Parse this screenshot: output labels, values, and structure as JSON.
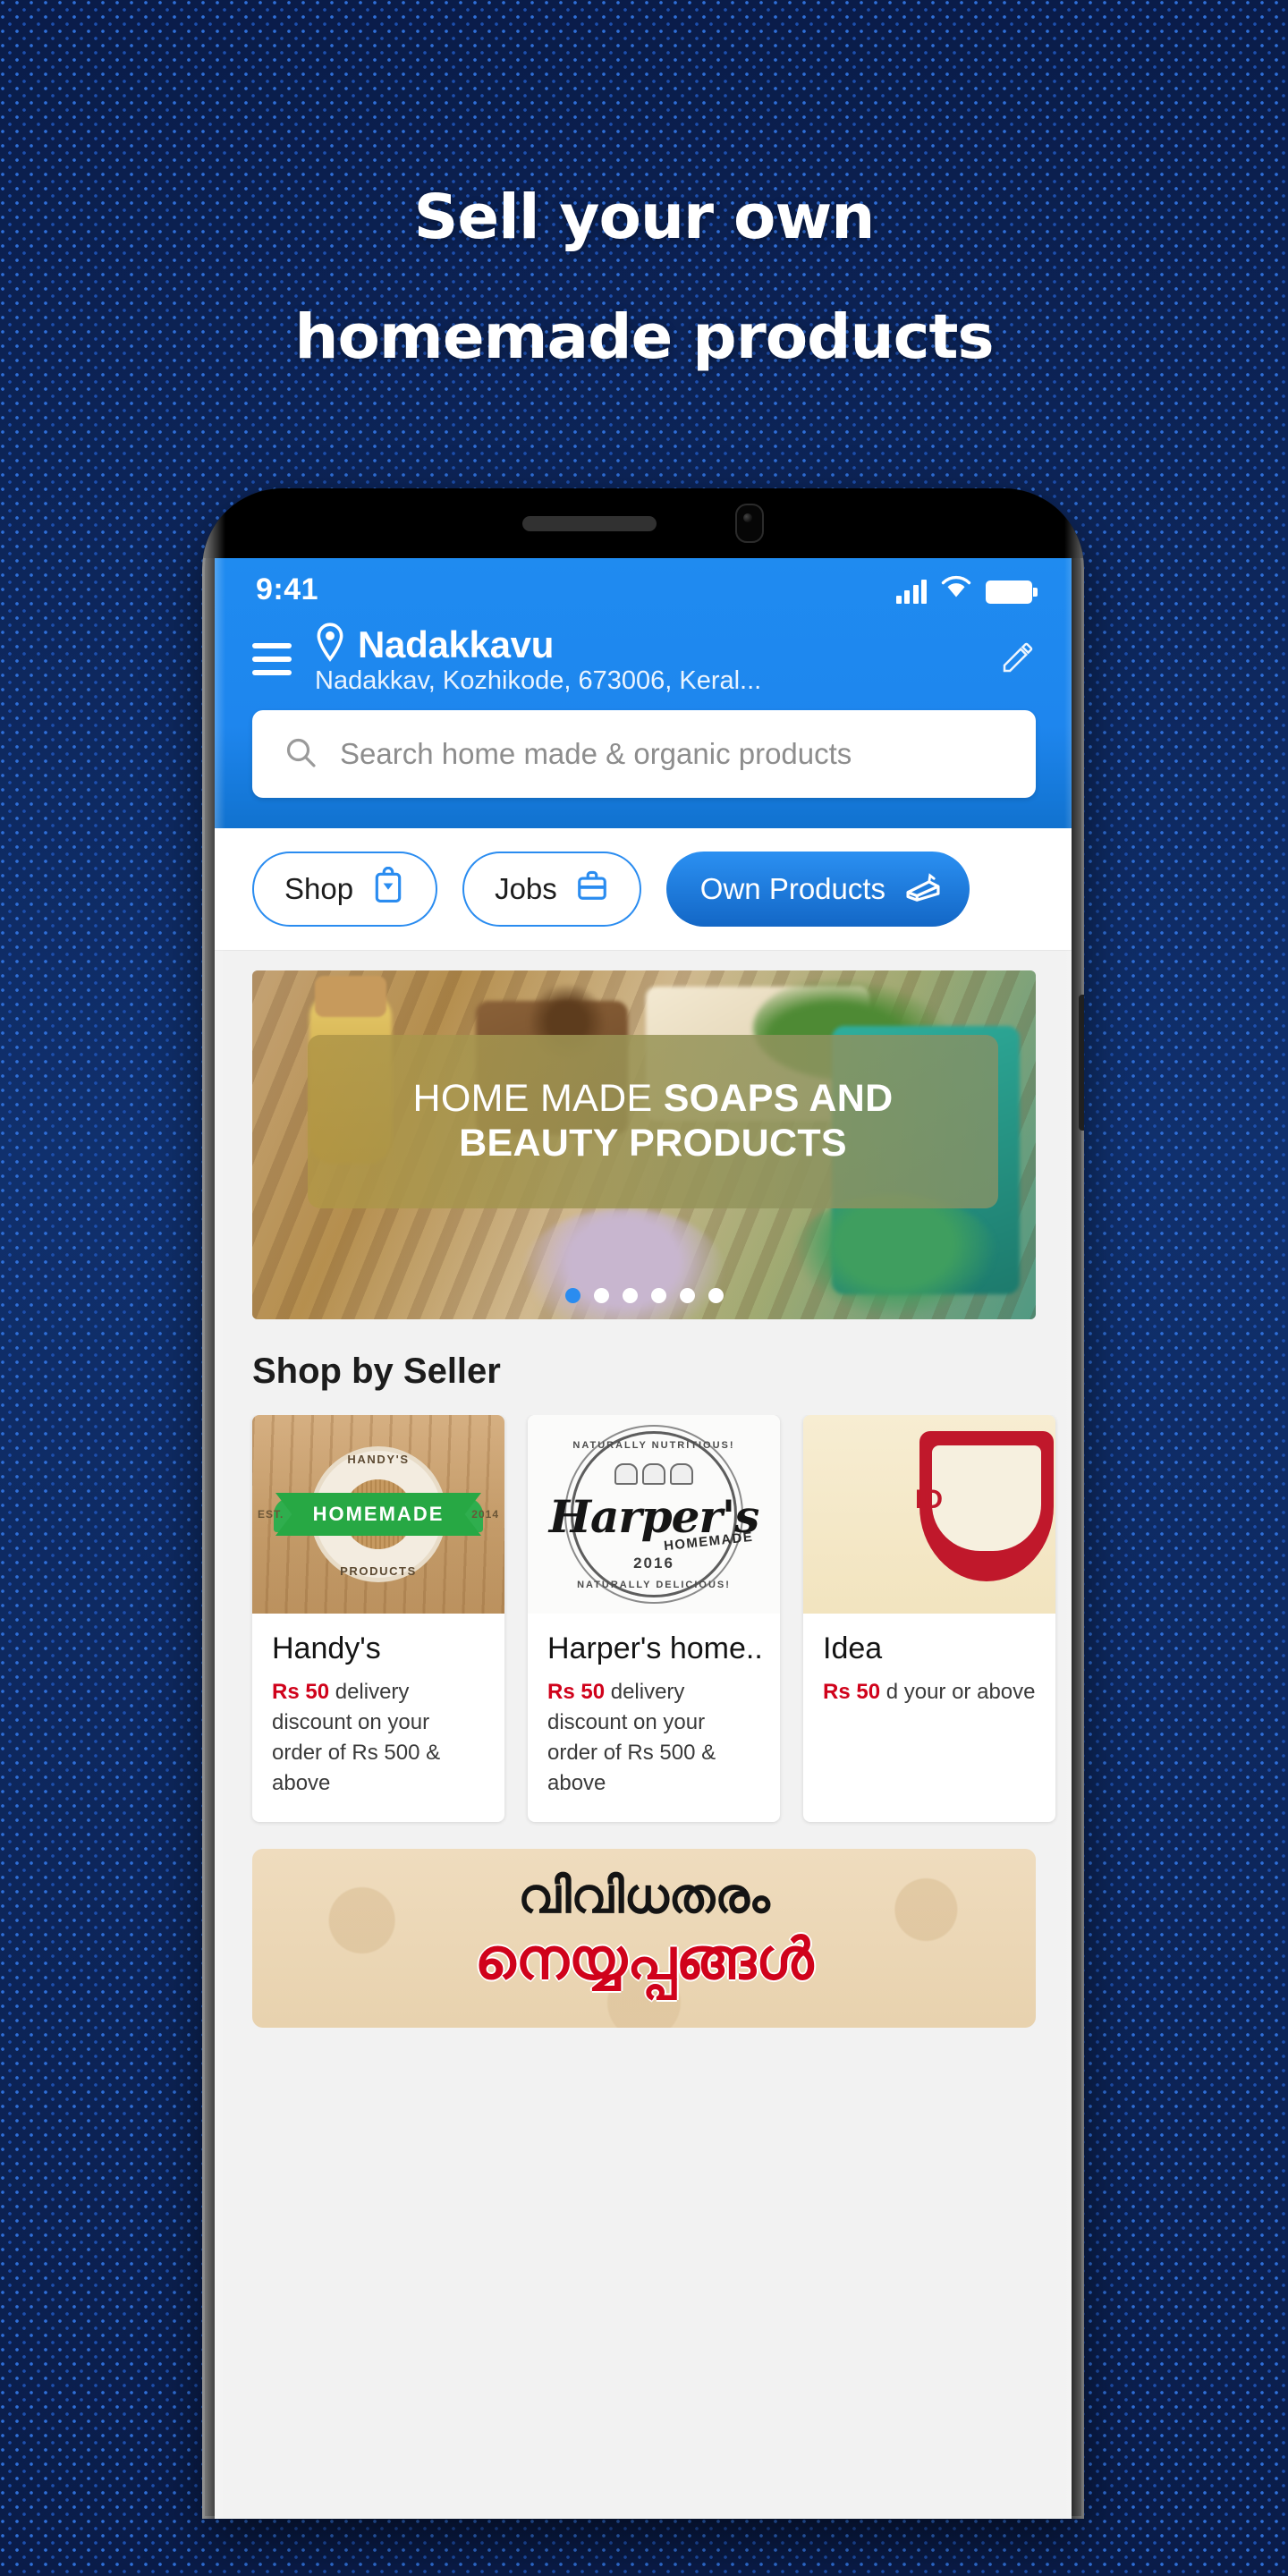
{
  "promo": {
    "headline_line1": "Sell your own",
    "headline_line2": "homemade products"
  },
  "phone": {
    "status_bar": {
      "time": "9:41",
      "signal_icon": "cellular-signal-icon",
      "wifi_icon": "wifi-icon",
      "battery_icon": "battery-icon"
    },
    "header": {
      "menu_icon": "hamburger-menu-icon",
      "location_pin_icon": "location-pin-icon",
      "location_title": "Nadakkavu",
      "location_address": "Nadakkav, Kozhikode, 673006, Keral...",
      "edit_icon": "pencil-edit-icon"
    },
    "search": {
      "icon": "search-icon",
      "placeholder": "Search home made & organic products",
      "value": ""
    },
    "chips": [
      {
        "label": "Shop",
        "icon": "shopping-bag-icon",
        "active": false
      },
      {
        "label": "Jobs",
        "icon": "briefcase-icon",
        "active": false
      },
      {
        "label": "Own Products",
        "icon": "cake-slice-icon",
        "active": true
      }
    ],
    "banner": {
      "title_light": "HOME MADE ",
      "title_bold": "SOAPS AND",
      "title_line2": "BEAUTY PRODUCTS",
      "dots_total": 6,
      "dots_active_index": 0
    },
    "sellers": {
      "section_title": "Shop by Seller",
      "cards": [
        {
          "name": "Handy's",
          "offer_highlight": "Rs 50",
          "offer_rest": " delivery discount on your order of Rs 500 & above",
          "logo": {
            "top_text": "HANDY'S",
            "bottom_text": "PRODUCTS",
            "ribbon_text": "HOMEMADE",
            "est_left": "EST.",
            "est_right": "2014"
          }
        },
        {
          "name": "Harper's home...",
          "offer_highlight": "Rs 50",
          "offer_rest": " delivery discount on your order of Rs 500 & above",
          "logo": {
            "top_text": "NATURALLY NUTRITIOUS!",
            "bottom_text": "NATURALLY DELICIOUS!",
            "name_text": "Harper's",
            "sub_text": "HOMEMADE",
            "year": "2016"
          }
        },
        {
          "name": "Idea",
          "offer_highlight": "Rs 50",
          "offer_rest": " d  your or above",
          "logo": {
            "badge_text": "ID"
          }
        }
      ]
    },
    "promo_banner": {
      "line1": "വിവിധതരം",
      "line2": "നെയ്യപ്പങ്ങൾ"
    }
  },
  "colors": {
    "background": "#0c2255",
    "app_blue": "#1e86ee",
    "accent_blue": "#2a8cf0",
    "offer_red": "#d0021b"
  }
}
